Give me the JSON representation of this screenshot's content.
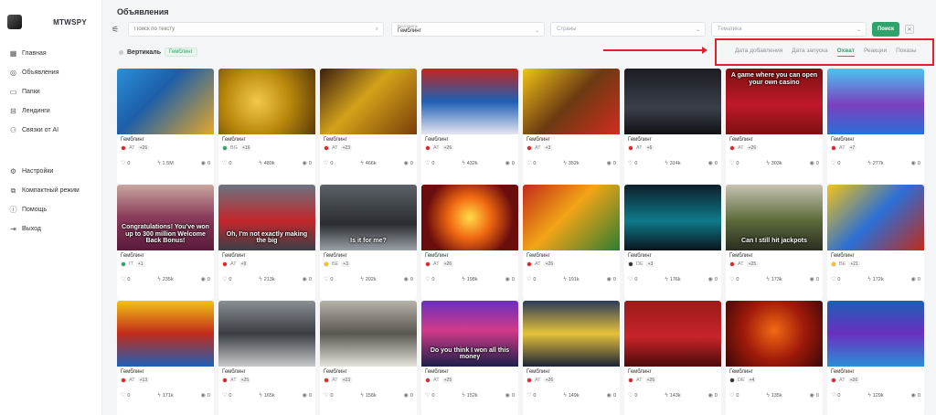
{
  "app": {
    "name": "MTWSPY"
  },
  "sidebar": {
    "items": [
      {
        "label": "Главная",
        "icon": "grid-icon",
        "glyph": "▦"
      },
      {
        "label": "Объявления",
        "icon": "compass-icon",
        "glyph": "◎"
      },
      {
        "label": "Папки",
        "icon": "folder-icon",
        "glyph": "▭"
      },
      {
        "label": "Лендинги",
        "icon": "briefcase-icon",
        "glyph": "⊟"
      },
      {
        "label": "Связки от AI",
        "icon": "link-icon",
        "glyph": "⚇"
      }
    ],
    "bottom_items": [
      {
        "label": "Настройки",
        "icon": "gear-icon",
        "glyph": "⚙"
      },
      {
        "label": "Компактный режим",
        "icon": "compact-icon",
        "glyph": "⧉"
      },
      {
        "label": "Помощь",
        "icon": "help-icon",
        "glyph": "ⓘ"
      },
      {
        "label": "Выход",
        "icon": "logout-icon",
        "glyph": "⇥"
      }
    ]
  },
  "header": {
    "title": "Объявления"
  },
  "filters": {
    "search_placeholder": "Поиск по тексту",
    "vertical_label": "Вертикаль",
    "vertical_value": "Гемблинг",
    "countries_placeholder": "Страны",
    "topic_placeholder": "Тематика",
    "search_button": "Поиск"
  },
  "active_filter": {
    "label": "Вертикаль",
    "value": "Гемблинг"
  },
  "sort_tabs": [
    {
      "label": "Дата добавления",
      "active": false
    },
    {
      "label": "Дата запуска",
      "active": false
    },
    {
      "label": "Охват",
      "active": true
    },
    {
      "label": "Реакции",
      "active": false
    },
    {
      "label": "Показы",
      "active": false
    }
  ],
  "cards": [
    {
      "vertical": "Гемблинг",
      "country": "AT",
      "more": "+26",
      "likes": "0",
      "reach": "1.5M",
      "views": "0",
      "bg": "linear-gradient(135deg,#2b8fd6,#1c5fa8 40%,#e5a72b)",
      "flag": "#e0202a",
      "caption": "",
      "glyph": ""
    },
    {
      "vertical": "Гемблинг",
      "country": "BG",
      "more": "+16",
      "likes": "0",
      "reach": "489k",
      "views": "0",
      "bg": "radial-gradient(circle at 40% 50%,#f3c94a,#b8860b 50%,#5a3a0a)",
      "flag": "#2fa36b",
      "caption": "",
      "glyph": ""
    },
    {
      "vertical": "Гемблинг",
      "country": "AT",
      "more": "+23",
      "likes": "0",
      "reach": "466k",
      "views": "0",
      "bg": "linear-gradient(135deg,#3b1f0f,#d4a21a 45%,#7a3d0a)",
      "flag": "#e0202a",
      "caption": "",
      "glyph": ""
    },
    {
      "vertical": "Гемблинг",
      "country": "AT",
      "more": "+26",
      "likes": "0",
      "reach": "432k",
      "views": "0",
      "bg": "linear-gradient(180deg,#c2261e,#1d5fb5 50%,#e6e6f2)",
      "flag": "#e0202a",
      "caption": "",
      "glyph": ""
    },
    {
      "vertical": "Гемблинг",
      "country": "AT",
      "more": "+3",
      "likes": "0",
      "reach": "352k",
      "views": "0",
      "bg": "linear-gradient(135deg,#f2c316,#6b3a12 50%,#d22c1f)",
      "flag": "#e0202a",
      "caption": "",
      "glyph": ""
    },
    {
      "vertical": "Гемблинг",
      "country": "AT",
      "more": "+6",
      "likes": "0",
      "reach": "314k",
      "views": "0",
      "bg": "linear-gradient(180deg,#1b1d22,#3a3f4a 60%,#101114)",
      "flag": "#e0202a",
      "caption": "",
      "glyph": ""
    },
    {
      "vertical": "Гемблинг",
      "country": "AT",
      "more": "+26",
      "likes": "0",
      "reach": "303k",
      "views": "0",
      "bg": "linear-gradient(180deg,#7c1010,#c0192a 55%,#7c1010)",
      "flag": "#e0202a",
      "caption": "A game where you can open your own casino",
      "glyph": ""
    },
    {
      "vertical": "Гемблинг",
      "country": "AT",
      "more": "+7",
      "likes": "0",
      "reach": "277k",
      "views": "0",
      "bg": "linear-gradient(180deg,#4cc3f2,#7b3fbf 55%,#2b6fd6)",
      "flag": "#e0202a",
      "caption": "",
      "glyph": ""
    },
    {
      "vertical": "Гемблинг",
      "country": "IT",
      "more": "+1",
      "likes": "0",
      "reach": "235k",
      "views": "0",
      "bg": "linear-gradient(180deg,#c9a6a0,#8a3a5a 50%,#5a1a3a)",
      "flag": "#2fa36b",
      "caption": "Congratulations! You've won up to 300 million Welcome Back Bonus!",
      "glyph": ""
    },
    {
      "vertical": "Гемблинг",
      "country": "AT",
      "more": "+9",
      "likes": "0",
      "reach": "213k",
      "views": "0",
      "bg": "linear-gradient(180deg,#6b7480,#c3262b 55%,#3a3f48)",
      "flag": "#e0202a",
      "caption": "Oh, I'm not exactly making the big",
      "glyph": ""
    },
    {
      "vertical": "Гемблинг",
      "country": "BE",
      "more": "+3",
      "likes": "0",
      "reach": "202k",
      "views": "0",
      "bg": "linear-gradient(180deg,#5b6166,#2a2d31 60%,#9aa0a6)",
      "flag": "#f2c316",
      "caption": "Is it for me?",
      "glyph": ""
    },
    {
      "vertical": "Гемблинг",
      "country": "AT",
      "more": "+26",
      "likes": "0",
      "reach": "198k",
      "views": "0",
      "bg": "radial-gradient(circle at 50% 50%,#ffdc4a,#f26a12 35%,#6a0d0d 75%)",
      "flag": "#e0202a",
      "caption": "",
      "glyph": ""
    },
    {
      "vertical": "Гемблинг",
      "country": "AT",
      "more": "+26",
      "likes": "0",
      "reach": "191k",
      "views": "0",
      "bg": "linear-gradient(135deg,#c22a1a,#f2a516 45%,#2e7d32)",
      "flag": "#e0202a",
      "caption": "",
      "glyph": ""
    },
    {
      "vertical": "Гемблинг",
      "country": "DE",
      "more": "+3",
      "likes": "0",
      "reach": "176k",
      "views": "0",
      "bg": "linear-gradient(180deg,#0d1f2a,#0f7a8a 55%,#0a141c)",
      "flag": "#2b2f36",
      "caption": "",
      "glyph": ""
    },
    {
      "vertical": "Гемблинг",
      "country": "AT",
      "more": "+25",
      "likes": "0",
      "reach": "173k",
      "views": "0",
      "bg": "linear-gradient(180deg,#c7c2b0,#5a6a3a 55%,#2a2d22)",
      "flag": "#e0202a",
      "caption": "Can I still hit jackpots",
      "glyph": ""
    },
    {
      "vertical": "Гемблинг",
      "country": "BE",
      "more": "+21",
      "likes": "0",
      "reach": "172k",
      "views": "0",
      "bg": "linear-gradient(135deg,#f2c316,#2b6fd6 50%,#c22a1a)",
      "flag": "#f2c316",
      "caption": "",
      "glyph": ""
    },
    {
      "vertical": "Гемблинг",
      "country": "AT",
      "more": "+13",
      "likes": "0",
      "reach": "171k",
      "views": "0",
      "bg": "linear-gradient(180deg,#f2c316,#c22a1a 50%,#1d5fb5)",
      "flag": "#e0202a",
      "caption": "",
      "glyph": ""
    },
    {
      "vertical": "Гемблинг",
      "country": "AT",
      "more": "+25",
      "likes": "0",
      "reach": "165k",
      "views": "0",
      "bg": "linear-gradient(180deg,#8a8f94,#3a3d42 50%,#c7c9cc)",
      "flag": "#e0202a",
      "caption": "",
      "glyph": ""
    },
    {
      "vertical": "Гемблинг",
      "country": "AT",
      "more": "+23",
      "likes": "0",
      "reach": "158k",
      "views": "0",
      "bg": "linear-gradient(180deg,#b5b2aa,#5a5650 50%,#e6e3dc)",
      "flag": "#e0202a",
      "caption": "",
      "glyph": ""
    },
    {
      "vertical": "Гемблинг",
      "country": "AT",
      "more": "+25",
      "likes": "0",
      "reach": "152k",
      "views": "0",
      "bg": "linear-gradient(180deg,#6a2fbf,#d23a8a 45%,#1d1f4a)",
      "flag": "#e0202a",
      "caption": "Do you think I won all this money",
      "glyph": ""
    },
    {
      "vertical": "Гемблинг",
      "country": "AT",
      "more": "+26",
      "likes": "0",
      "reach": "149k",
      "views": "0",
      "bg": "linear-gradient(180deg,#2b3a5a,#e6c23a 50%,#1a2336)",
      "flag": "#e0202a",
      "caption": "",
      "glyph": ""
    },
    {
      "vertical": "Гемблинг",
      "country": "AT",
      "more": "+26",
      "likes": "0",
      "reach": "143k",
      "views": "0",
      "bg": "linear-gradient(180deg,#9a1a1a,#c8242a 55%,#4a0a0a)",
      "flag": "#e0202a",
      "caption": "",
      "glyph": ""
    },
    {
      "vertical": "Гемблинг",
      "country": "DE",
      "more": "+4",
      "likes": "0",
      "reach": "135k",
      "views": "0",
      "bg": "radial-gradient(circle at 50% 45%,#f26a12,#a01a0a 50%,#3a0808)",
      "flag": "#2b2f36",
      "caption": "",
      "glyph": ""
    },
    {
      "vertical": "Гемблинг",
      "country": "AT",
      "more": "+26",
      "likes": "0",
      "reach": "129k",
      "views": "0",
      "bg": "linear-gradient(180deg,#1d5fb5,#6a2fbf 50%,#2b8fd6)",
      "flag": "#e0202a",
      "caption": "",
      "glyph": ""
    }
  ]
}
